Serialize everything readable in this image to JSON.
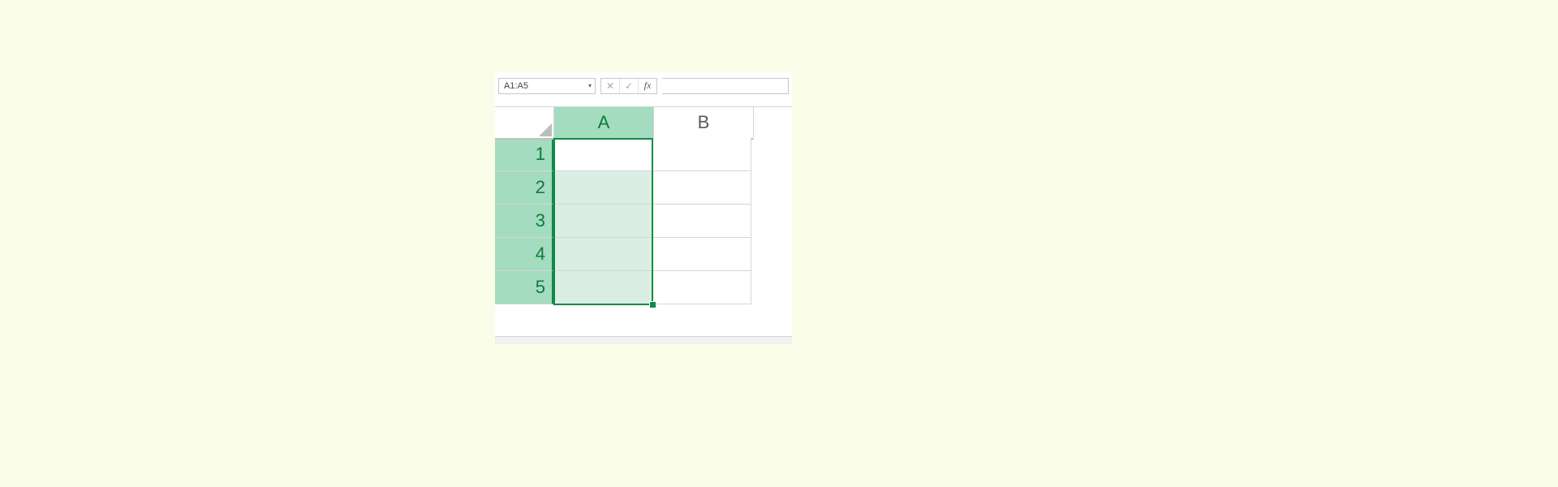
{
  "name_box": {
    "value": "A1:A5"
  },
  "formula_bar": {
    "cancel_tip": "✕",
    "enter_tip": "✓",
    "fx_label": "fx",
    "value": ""
  },
  "columns": [
    "A",
    "B"
  ],
  "rows": [
    "1",
    "2",
    "3",
    "4",
    "5"
  ],
  "selection": {
    "col_selected_index": 0,
    "row_selected_from": 0,
    "row_selected_to": 4,
    "active_cell": "A1"
  },
  "cells": {
    "A1": "",
    "A2": "",
    "A3": "",
    "A4": "",
    "A5": "",
    "B1": "",
    "B2": "",
    "B3": "",
    "B4": "",
    "B5": ""
  }
}
